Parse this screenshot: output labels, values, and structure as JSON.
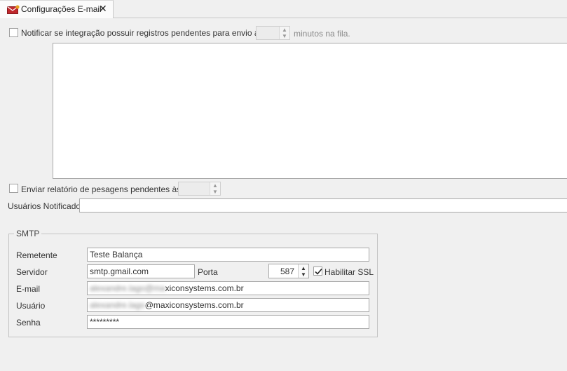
{
  "tab": {
    "label": "Configurações E-mail",
    "close": "✕",
    "icon": "envelope-icon"
  },
  "notify": {
    "checked": false,
    "label": "Notificar se integração possuir registros pendentes para envio após",
    "minutes_value": "",
    "suffix": "minutos na fila.",
    "message_value": ""
  },
  "report": {
    "checked": false,
    "label": "Enviar relatório de pesagens pendentes às",
    "time_value": ""
  },
  "notified_users": {
    "label": "Usuários Notificados",
    "value": ""
  },
  "smtp": {
    "title": "SMTP",
    "sender_label": "Remetente",
    "sender_value": "Teste Balança",
    "server_label": "Servidor",
    "server_value": "smtp.gmail.com",
    "port_label": "Porta",
    "port_value": "587",
    "ssl_label": "Habilitar SSL",
    "ssl_checked": true,
    "email_label": "E-mail",
    "email_hidden": "alexandre.lago@ma",
    "email_visible": "xiconsystems.com.br",
    "user_label": "Usuário",
    "user_hidden": "alexandre.lago",
    "user_visible": "@maxiconsystems.com.br",
    "password_label": "Senha",
    "password_value": "*********"
  }
}
